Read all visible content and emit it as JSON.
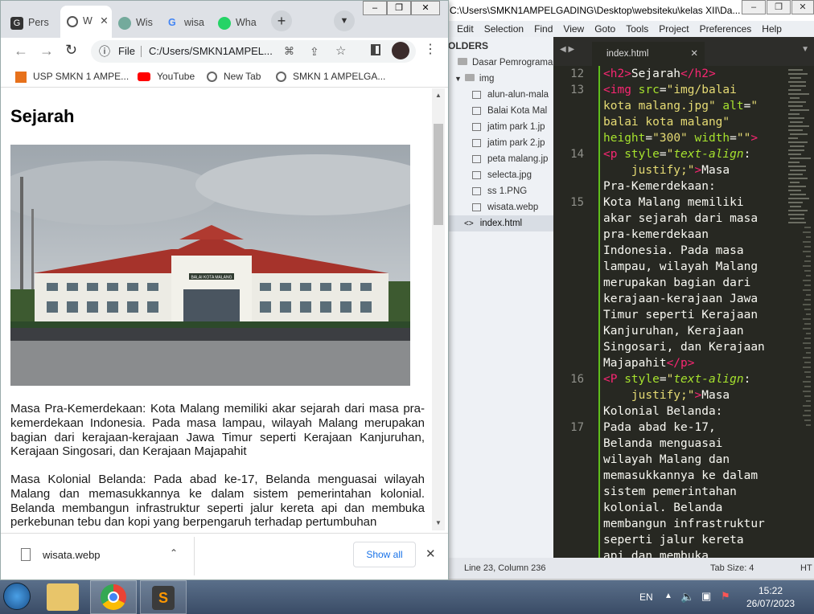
{
  "sublime": {
    "title": "C:\\Users\\SMKN1AMPELGADING\\Desktop\\websiteku\\kelas XII\\Da...",
    "menu": [
      "Edit",
      "Selection",
      "Find",
      "View",
      "Goto",
      "Tools",
      "Project",
      "Preferences",
      "Help"
    ],
    "sidebar": {
      "header": "OLDERS",
      "folder": "Dasar Pemrograma",
      "subfolder": "img",
      "files": [
        "alun-alun-mala",
        "Balai Kota Mal",
        "jatim park 1.jp",
        "jatim park 2.jp",
        "peta malang.jp",
        "selecta.jpg",
        "ss 1.PNG",
        "wisata.webp"
      ],
      "open_file": "index.html"
    },
    "tab": "index.html",
    "line_numbers": [
      {
        "n": "12",
        "row": 0
      },
      {
        "n": "13",
        "row": 1
      },
      {
        "n": "14",
        "row": 5
      },
      {
        "n": "15",
        "row": 8
      },
      {
        "n": "16",
        "row": 19
      },
      {
        "n": "17",
        "row": 22
      }
    ],
    "status": {
      "position": "Line 23, Column 236",
      "tabsize": "Tab Size: 4",
      "syntax": "HT"
    }
  },
  "chrome": {
    "tabs": [
      "Pers",
      "W",
      "Wis",
      "wisa",
      "Wha"
    ],
    "url_label": "File",
    "url": "C:/Users/SMKN1AMPEL...",
    "bookmarks": [
      "USP SMKN 1 AMPE...",
      "YouTube",
      "New Tab",
      "SMKN 1 AMPELGA..."
    ],
    "page": {
      "heading": "Sejarah",
      "para1": "Masa Pra-Kemerdekaan: Kota Malang memiliki akar sejarah dari masa pra-kemerdekaan Indonesia. Pada masa lampau, wilayah Malang merupakan bagian dari kerajaan-kerajaan Jawa Timur seperti Kerajaan Kanjuruhan, Kerajaan Singosari, dan Kerajaan Majapahit",
      "para2": "Masa Kolonial Belanda: Pada abad ke-17, Belanda menguasai wilayah Malang dan memasukkannya ke dalam sistem pemerintahan kolonial. Belanda membangun infrastruktur seperti jalur kereta api dan membuka perkebunan tebu dan kopi yang berpengaruh terhadap pertumbuhan",
      "building_sign": "BALAI KOTA MALANG"
    },
    "download": {
      "file": "wisata.webp",
      "show_all": "Show all"
    }
  },
  "taskbar": {
    "lang": "EN",
    "time": "15:22",
    "date": "26/07/2023"
  },
  "colors": {
    "accent": "#1a73e8",
    "editor_bg": "#272822",
    "tag": "#f92672",
    "attr": "#a6e22e",
    "string": "#e6db74"
  }
}
